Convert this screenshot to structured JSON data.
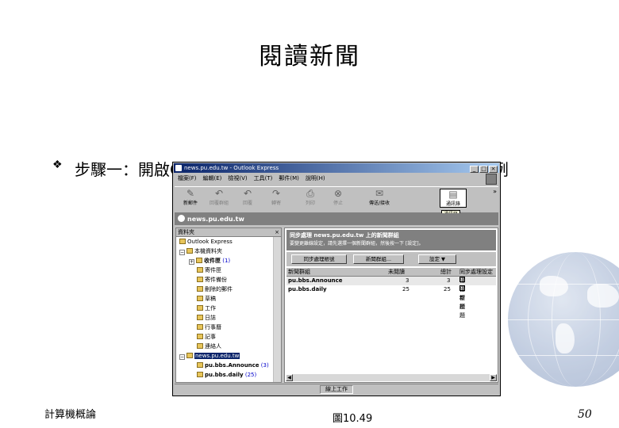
{
  "slide": {
    "title": "閱讀新聞",
    "bullet_mark": "❖",
    "bullet_text": "步驟一：開啟Outlook Express後，選取新聞群組資料夾，例",
    "footer_left": "計算機概論",
    "figure_label": "圖10.49",
    "page_number": "50"
  },
  "window": {
    "title": "news.pu.edu.tw - Outlook Express",
    "menu": [
      "檔案(F)",
      "編輯(E)",
      "檢視(V)",
      "工具(T)",
      "郵件(M)",
      "說明(H)"
    ],
    "toolbar": [
      {
        "label": "新郵件",
        "icon": "new-mail-icon"
      },
      {
        "label": "回覆群組",
        "icon": "reply-group-icon"
      },
      {
        "label": "回覆",
        "icon": "reply-icon"
      },
      {
        "label": "轉寄",
        "icon": "forward-icon"
      },
      {
        "label": "列印",
        "icon": "print-icon"
      },
      {
        "label": "停止",
        "icon": "stop-icon"
      },
      {
        "label": "傳送/接收",
        "icon": "send-receive-icon"
      },
      {
        "label": "通訊錄",
        "icon": "address-book-icon"
      }
    ],
    "tooltip": "通訊錄",
    "folder_bar": "news.pu.edu.tw",
    "folders_header": "資料夾",
    "tree": [
      {
        "label": "Outlook Express"
      },
      {
        "label": "本機資料夾"
      },
      {
        "label": "收件匣",
        "count": "(1)"
      },
      {
        "label": "寄件匣"
      },
      {
        "label": "寄件備份"
      },
      {
        "label": "刪除的郵件"
      },
      {
        "label": "草稿"
      },
      {
        "label": "工作"
      },
      {
        "label": "日誌"
      },
      {
        "label": "行事曆"
      },
      {
        "label": "記事"
      },
      {
        "label": "連絡人"
      },
      {
        "label": "news.pu.edu.tw"
      },
      {
        "label": "pu.bbs.Announce",
        "count": "(3)"
      },
      {
        "label": "pu.bbs.daily",
        "count": "(25)"
      }
    ],
    "sync": {
      "heading": "同步處理 news.pu.edu.tw 上的新聞群組",
      "subtext": "要變更離線設定，請先選擇一個新聞群組，然後按一下 [設定]。"
    },
    "buttons": {
      "sync_account": "同步處理帳號",
      "newsgroups": "新聞群組...",
      "settings": "設定 ▼"
    },
    "grid": {
      "headers": [
        "新聞群組",
        "未閱讀",
        "總計",
        "同步處理設定"
      ],
      "rows": [
        {
          "name": "pu.bbs.Announce",
          "unread": "3",
          "total": "3",
          "setting": "僅新標題"
        },
        {
          "name": "pu.bbs.daily",
          "unread": "25",
          "total": "25",
          "setting": "僅新標題"
        }
      ]
    },
    "status": "線上工作"
  }
}
